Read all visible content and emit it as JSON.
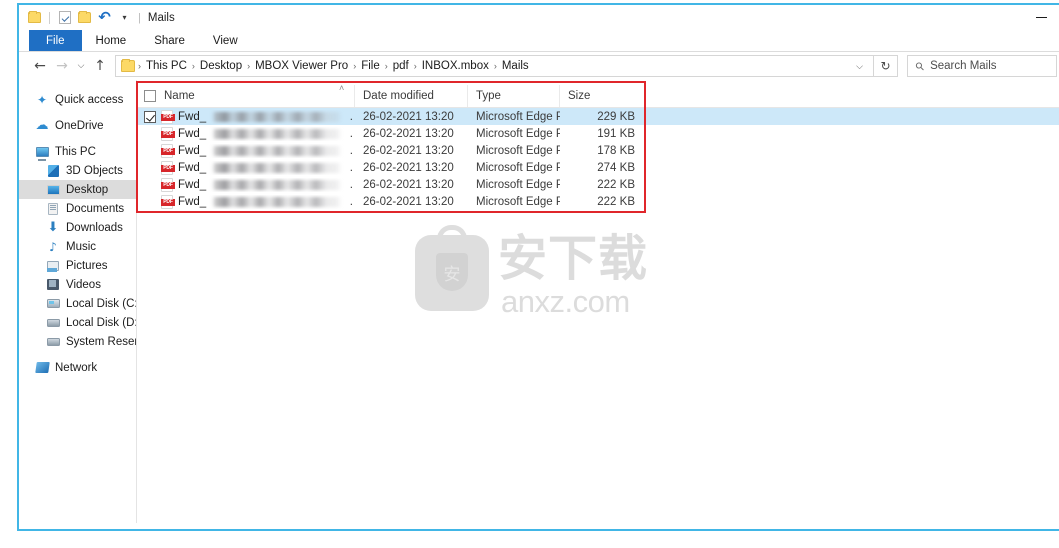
{
  "window": {
    "title": "Mails",
    "quick_access": [
      {
        "name": "folder-icon"
      },
      {
        "name": "properties-icon"
      },
      {
        "name": "new-folder-icon"
      },
      {
        "name": "undo-icon",
        "glyph": "↶"
      },
      {
        "name": "customize-caret-icon",
        "glyph": "▾"
      }
    ],
    "separator": "|",
    "minimize_label": ""
  },
  "ribbon": {
    "tabs": [
      {
        "label": "File",
        "active": true
      },
      {
        "label": "Home",
        "active": false
      },
      {
        "label": "Share",
        "active": false
      },
      {
        "label": "View",
        "active": false
      }
    ]
  },
  "addressbar": {
    "back": "←",
    "forward": "→",
    "recent": "⌵",
    "up": "↑",
    "breadcrumbs": [
      "This PC",
      "Desktop",
      "MBOX Viewer Pro",
      "File",
      "pdf",
      "INBOX.mbox",
      "Mails"
    ],
    "separator": "›",
    "dropdown": "⌵",
    "refresh": "↻",
    "search_placeholder": "Search Mails"
  },
  "navpane": {
    "items": [
      {
        "label": "Quick access",
        "icon": "star-icon",
        "indent": false,
        "selected": false
      },
      {
        "label": "OneDrive",
        "icon": "cloud-icon",
        "indent": false,
        "selected": false
      },
      {
        "label": "This PC",
        "icon": "computer-icon",
        "indent": false,
        "selected": false
      },
      {
        "label": "3D Objects",
        "icon": "3d-objects-icon",
        "indent": true,
        "selected": false
      },
      {
        "label": "Desktop",
        "icon": "desktop-icon",
        "indent": true,
        "selected": true
      },
      {
        "label": "Documents",
        "icon": "documents-icon",
        "indent": true,
        "selected": false
      },
      {
        "label": "Downloads",
        "icon": "downloads-icon",
        "indent": true,
        "selected": false
      },
      {
        "label": "Music",
        "icon": "music-icon",
        "indent": true,
        "selected": false
      },
      {
        "label": "Pictures",
        "icon": "pictures-icon",
        "indent": true,
        "selected": false
      },
      {
        "label": "Videos",
        "icon": "videos-icon",
        "indent": true,
        "selected": false
      },
      {
        "label": "Local Disk (C:)",
        "icon": "system-drive-icon",
        "indent": true,
        "selected": false
      },
      {
        "label": "Local Disk (D:)",
        "icon": "drive-icon",
        "indent": true,
        "selected": false
      },
      {
        "label": "System Reserved (F:",
        "icon": "drive-icon",
        "indent": true,
        "selected": false
      },
      {
        "label": "Network",
        "icon": "network-icon",
        "indent": false,
        "selected": false
      }
    ]
  },
  "filelist": {
    "columns": [
      {
        "key": "name",
        "label": "Name",
        "sorted": "asc"
      },
      {
        "key": "date",
        "label": "Date modified"
      },
      {
        "key": "type",
        "label": "Type"
      },
      {
        "key": "size",
        "label": "Size"
      }
    ],
    "sort_caret": "˄",
    "rows": [
      {
        "name": "Fwd_",
        "redacted": true,
        "suffix": ".",
        "date": "26-02-2021 13:20",
        "type": "Microsoft Edge P...",
        "size": "229 KB",
        "selected": true,
        "checked": true,
        "icon": "pdf-file-icon"
      },
      {
        "name": "Fwd_",
        "redacted": true,
        "suffix": ".",
        "date": "26-02-2021 13:20",
        "type": "Microsoft Edge P...",
        "size": "191 KB",
        "selected": false,
        "checked": false,
        "icon": "pdf-file-icon"
      },
      {
        "name": "Fwd_",
        "redacted": true,
        "suffix": ".",
        "date": "26-02-2021 13:20",
        "type": "Microsoft Edge P...",
        "size": "178 KB",
        "selected": false,
        "checked": false,
        "icon": "pdf-file-icon"
      },
      {
        "name": "Fwd_",
        "redacted": true,
        "suffix": ".",
        "date": "26-02-2021 13:20",
        "type": "Microsoft Edge P...",
        "size": "274 KB",
        "selected": false,
        "checked": false,
        "icon": "pdf-file-icon"
      },
      {
        "name": "Fwd_",
        "redacted": true,
        "suffix": ".",
        "date": "26-02-2021 13:20",
        "type": "Microsoft Edge P...",
        "size": "222 KB",
        "selected": false,
        "checked": false,
        "icon": "pdf-file-icon"
      },
      {
        "name": "Fwd_",
        "redacted": true,
        "suffix": ".",
        "date": "26-02-2021 13:20",
        "type": "Microsoft Edge P...",
        "size": "222 KB",
        "selected": false,
        "checked": false,
        "icon": "pdf-file-icon"
      }
    ]
  },
  "annotation": {
    "color": "#e0262b",
    "shape": "rectangle"
  },
  "watermark": {
    "cn_text": "安下载",
    "url_text": "anxz.com",
    "badge_char": "安",
    "color": "#dedede"
  },
  "colors": {
    "window_border": "#41b6e6",
    "tab_active_bg": "#1f6fc4",
    "selection_bg": "#cde8f9",
    "navitem_selected_bg": "#dcdcdc",
    "pdf_red": "#d7262a",
    "annotation_red": "#e0262b"
  }
}
